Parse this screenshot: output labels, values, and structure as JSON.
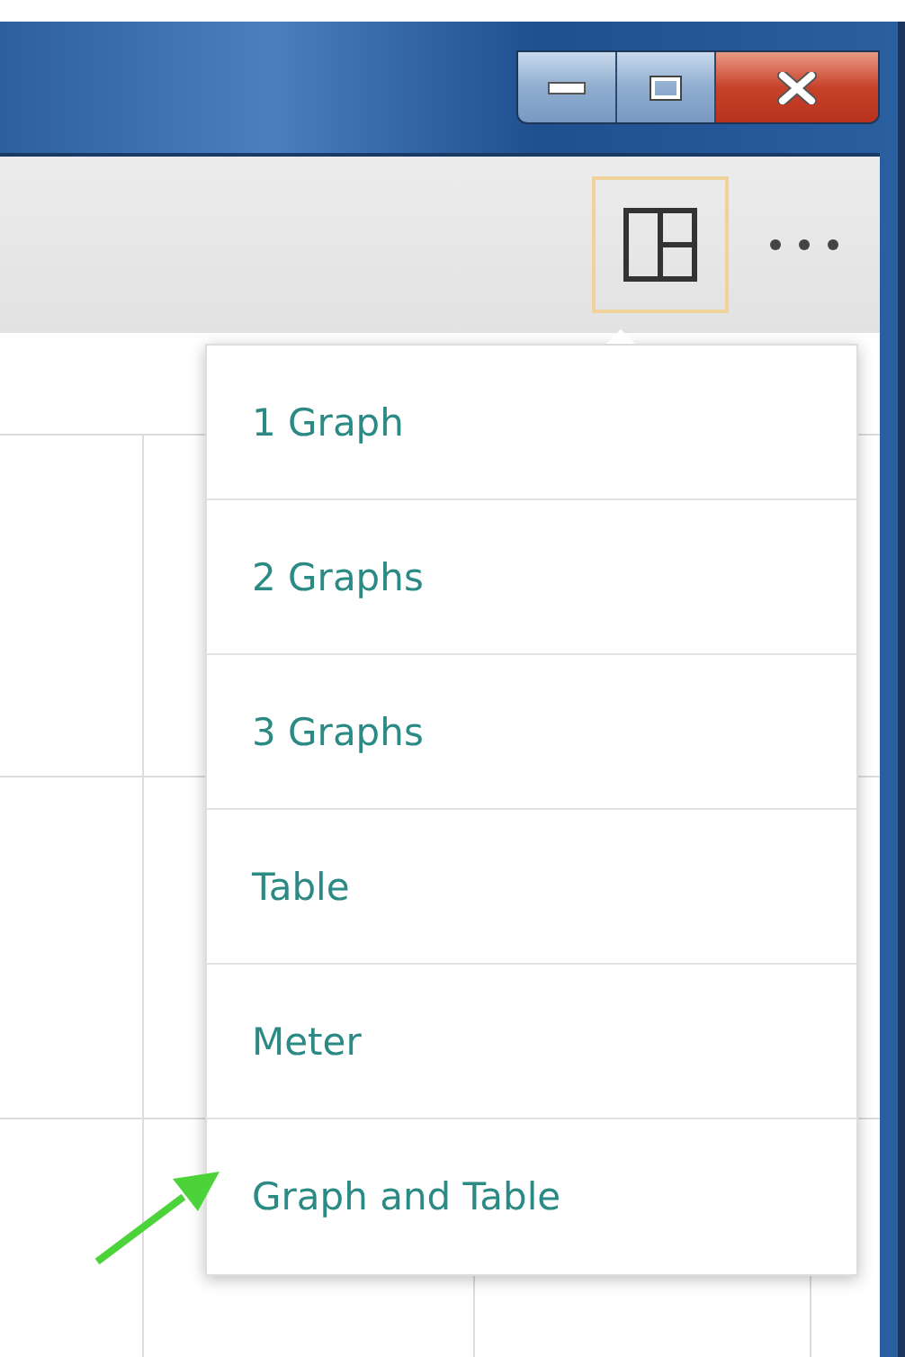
{
  "toolbar": {
    "layout_button": {
      "selected": true
    }
  },
  "layout_menu": {
    "items": [
      {
        "label": "1 Graph"
      },
      {
        "label": "2 Graphs"
      },
      {
        "label": "3 Graphs"
      },
      {
        "label": "Table"
      },
      {
        "label": "Meter"
      },
      {
        "label": "Graph and Table"
      }
    ]
  }
}
